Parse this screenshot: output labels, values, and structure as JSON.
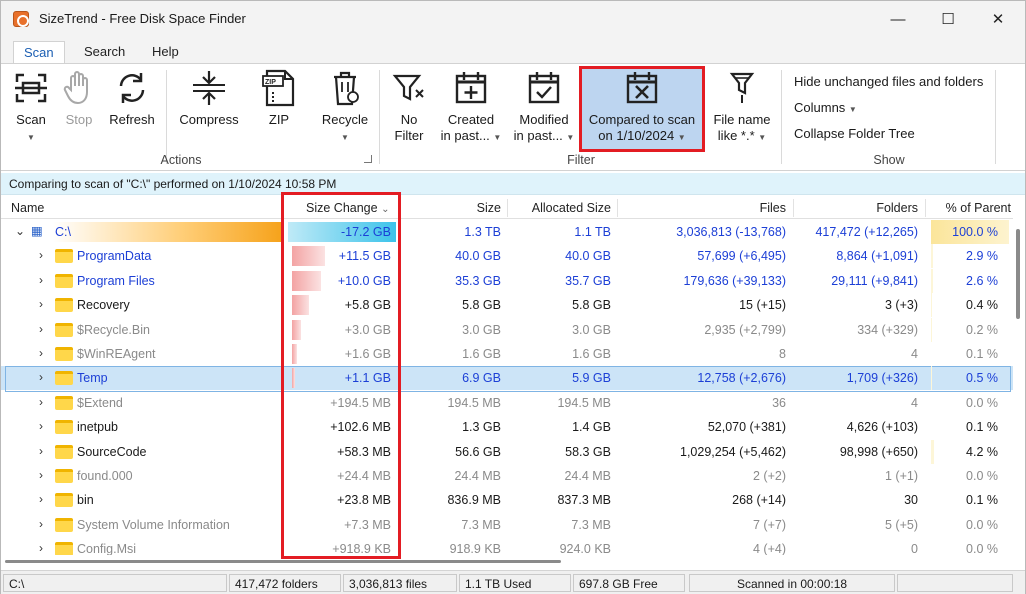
{
  "window": {
    "title": "SizeTrend - Free Disk Space Finder",
    "minimize": "—",
    "maximize": "☐",
    "close": "✕"
  },
  "tabs": [
    "Scan",
    "Search",
    "Help"
  ],
  "ribbon": {
    "actions": {
      "scan": "Scan",
      "stop": "Stop",
      "refresh": "Refresh",
      "compress": "Compress",
      "zip": "ZIP",
      "recycle": "Recycle",
      "group": "Actions"
    },
    "filter": {
      "no_filter_1": "No",
      "no_filter_2": "Filter",
      "created_1": "Created",
      "created_2": "in past...",
      "modified_1": "Modified",
      "modified_2": "in past...",
      "compared_1": "Compared to scan",
      "compared_2": "on 1/10/2024",
      "filename_1": "File name",
      "filename_2": "like *.*",
      "group": "Filter"
    },
    "show": {
      "hide_unchanged": "Hide unchanged files and folders",
      "columns": "Columns",
      "collapse": "Collapse Folder Tree",
      "group": "Show"
    }
  },
  "infobar": "Comparing to scan of \"C:\\\" performed on 1/10/2024 10:58 PM",
  "columns": {
    "name": "Name",
    "size_change": "Size Change",
    "size": "Size",
    "allocated": "Allocated Size",
    "files": "Files",
    "folders": "Folders",
    "pct": "% of Parent"
  },
  "rows": [
    {
      "name": "C:\\",
      "change": "-17.2 GB",
      "size": "1.3 TB",
      "alloc": "1.1 TB",
      "files": "3,036,813 (-13,768)",
      "folders": "417,472 (+12,265)",
      "pct": "100.0 %",
      "color": "blue",
      "bar": 0,
      "pctfill": 1.0
    },
    {
      "name": "ProgramData",
      "change": "+11.5 GB",
      "size": "40.0 GB",
      "alloc": "40.0 GB",
      "files": "57,699 (+6,495)",
      "folders": "8,864 (+1,091)",
      "pct": "2.9 %",
      "color": "blue",
      "bar": 0.33,
      "pctfill": 0.029
    },
    {
      "name": "Program Files",
      "change": "+10.0 GB",
      "size": "35.3 GB",
      "alloc": "35.7 GB",
      "files": "179,636 (+39,133)",
      "folders": "29,111 (+9,841)",
      "pct": "2.6 %",
      "color": "blue",
      "bar": 0.29,
      "pctfill": 0.026
    },
    {
      "name": "Recovery",
      "change": "+5.8 GB",
      "size": "5.8 GB",
      "alloc": "5.8 GB",
      "files": "15 (+15)",
      "folders": "3 (+3)",
      "pct": "0.4 %",
      "color": "dark",
      "bar": 0.17,
      "pctfill": 0.004
    },
    {
      "name": "$Recycle.Bin",
      "change": "+3.0 GB",
      "size": "3.0 GB",
      "alloc": "3.0 GB",
      "files": "2,935 (+2,799)",
      "folders": "334 (+329)",
      "pct": "0.2 %",
      "color": "grey",
      "bar": 0.09,
      "pctfill": 0.002
    },
    {
      "name": "$WinREAgent",
      "change": "+1.6 GB",
      "size": "1.6 GB",
      "alloc": "1.6 GB",
      "files": "8",
      "folders": "4",
      "pct": "0.1 %",
      "color": "grey",
      "bar": 0.05,
      "pctfill": 0.001
    },
    {
      "name": "Temp",
      "change": "+1.1 GB",
      "size": "6.9 GB",
      "alloc": "5.9 GB",
      "files": "12,758 (+2,676)",
      "folders": "1,709 (+326)",
      "pct": "0.5 %",
      "color": "blue",
      "bar": 0.03,
      "pctfill": 0.005,
      "selected": true
    },
    {
      "name": "$Extend",
      "change": "+194.5 MB",
      "size": "194.5 MB",
      "alloc": "194.5 MB",
      "files": "36",
      "folders": "4",
      "pct": "0.0 %",
      "color": "grey",
      "bar": 0,
      "pctfill": 0
    },
    {
      "name": "inetpub",
      "change": "+102.6 MB",
      "size": "1.3 GB",
      "alloc": "1.4 GB",
      "files": "52,070 (+381)",
      "folders": "4,626 (+103)",
      "pct": "0.1 %",
      "color": "dark",
      "bar": 0,
      "pctfill": 0.001
    },
    {
      "name": "SourceCode",
      "change": "+58.3 MB",
      "size": "56.6 GB",
      "alloc": "58.3 GB",
      "files": "1,029,254 (+5,462)",
      "folders": "98,998 (+650)",
      "pct": "4.2 %",
      "color": "dark",
      "bar": 0,
      "pctfill": 0.042
    },
    {
      "name": "found.000",
      "change": "+24.4 MB",
      "size": "24.4 MB",
      "alloc": "24.4 MB",
      "files": "2 (+2)",
      "folders": "1 (+1)",
      "pct": "0.0 %",
      "color": "grey",
      "bar": 0,
      "pctfill": 0
    },
    {
      "name": "bin",
      "change": "+23.8 MB",
      "size": "836.9 MB",
      "alloc": "837.3 MB",
      "files": "268 (+14)",
      "folders": "30",
      "pct": "0.1 %",
      "color": "dark",
      "bar": 0,
      "pctfill": 0.001
    },
    {
      "name": "System Volume Information",
      "change": "+7.3 MB",
      "size": "7.3 MB",
      "alloc": "7.3 MB",
      "files": "7 (+7)",
      "folders": "5 (+5)",
      "pct": "0.0 %",
      "color": "grey",
      "bar": 0,
      "pctfill": 0
    },
    {
      "name": "Config.Msi",
      "change": "+918.9 KB",
      "size": "918.9 KB",
      "alloc": "924.0 KB",
      "files": "4 (+4)",
      "folders": "0",
      "pct": "0.0 %",
      "color": "grey",
      "bar": 0,
      "pctfill": 0
    }
  ],
  "status": {
    "path": "C:\\",
    "folders": "417,472 folders",
    "files": "3,036,813 files",
    "used": "1.1 TB Used",
    "free": "697.8 GB Free",
    "scanned": "Scanned in 00:00:18"
  },
  "colors": {
    "accent": "#1c5fb3",
    "highlight": "#e31c23",
    "selected_row": "#cce4f7",
    "info_bar": "#dff3fb"
  }
}
